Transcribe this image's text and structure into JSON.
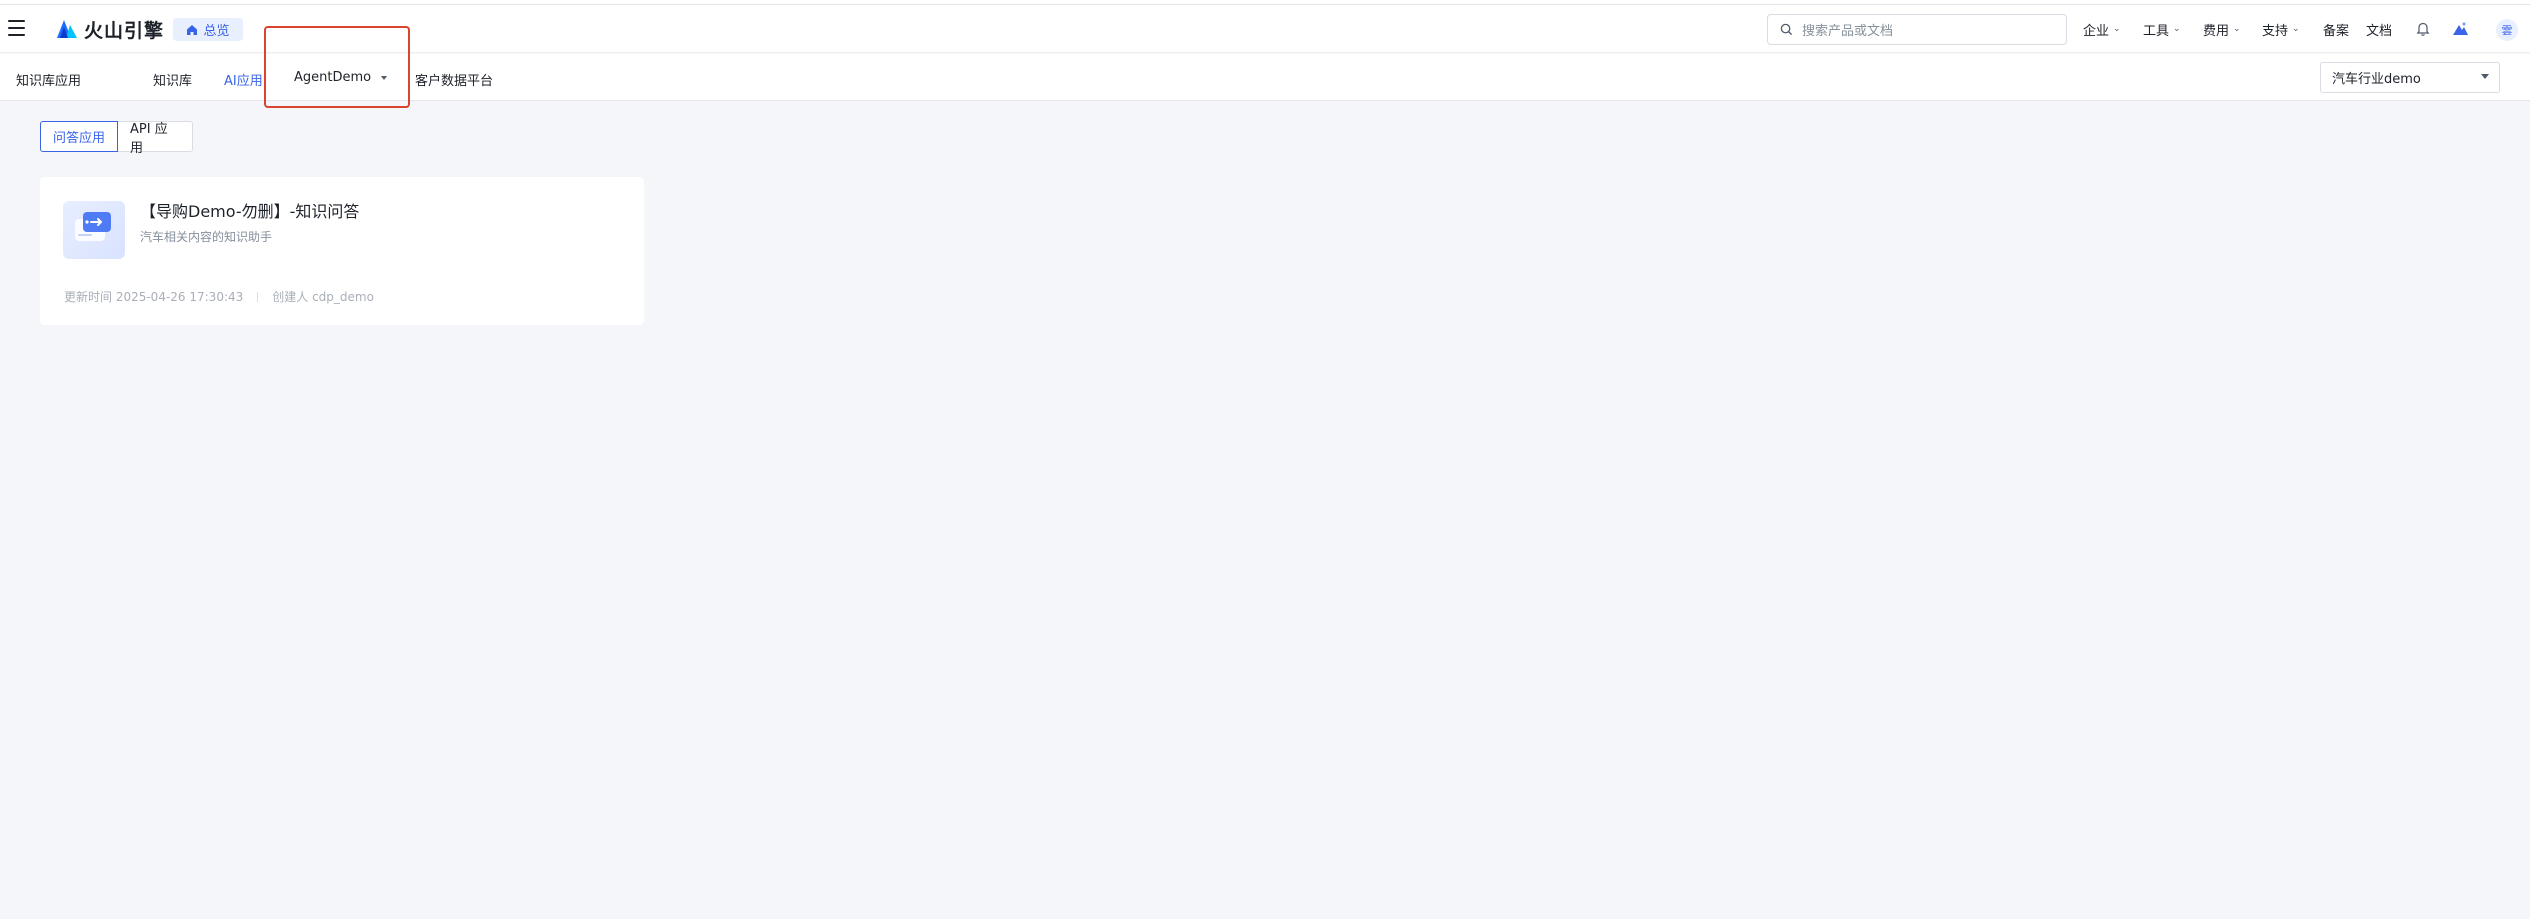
{
  "header": {
    "logo_text": "火山引擎",
    "overview_label": "总览",
    "search_placeholder": "搜索产品或文档",
    "menus": [
      {
        "label": "企业"
      },
      {
        "label": "工具"
      },
      {
        "label": "费用"
      },
      {
        "label": "支持"
      }
    ],
    "links": [
      {
        "label": "备案"
      },
      {
        "label": "文档"
      }
    ],
    "avatar_text": "雲"
  },
  "subnav": {
    "section_title": "知识库应用",
    "items": [
      {
        "label": "知识库"
      },
      {
        "label": "AI应用"
      },
      {
        "label": "AgentDemo"
      },
      {
        "label": "客户数据平台"
      }
    ],
    "space_select_value": "汽车行业demo"
  },
  "tabs": [
    {
      "label": "问答应用"
    },
    {
      "label": "API 应用"
    }
  ],
  "card": {
    "title": "【导购Demo-勿删】-知识问答",
    "description": "汽车相关内容的知识助手",
    "updated": "更新时间 2025-04-26 17:30:43",
    "creator": "创建人 cdp_demo"
  },
  "colors": {
    "accent": "#3a64e8",
    "highlight_box": "#d8442d",
    "background": "#f5f6fa"
  }
}
